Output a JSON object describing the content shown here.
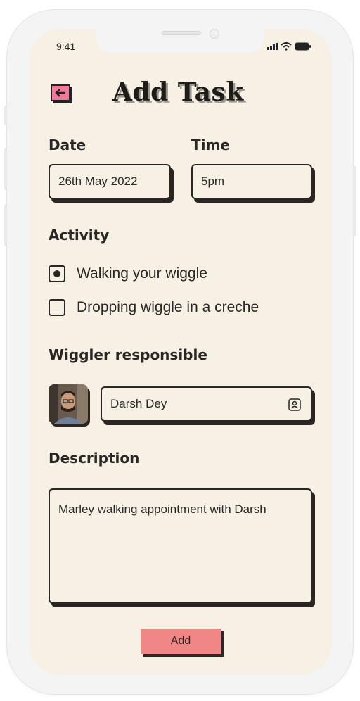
{
  "status_bar": {
    "time": "9:41"
  },
  "header": {
    "title": "Add Task"
  },
  "date": {
    "label": "Date",
    "value": "26th May 2022"
  },
  "time": {
    "label": "Time",
    "value": "5pm"
  },
  "activity": {
    "label": "Activity",
    "options": [
      {
        "label": "Walking your wiggle",
        "checked": true
      },
      {
        "label": "Dropping wiggle in a creche",
        "checked": false
      }
    ]
  },
  "responsible": {
    "label": "Wiggler responsible",
    "name": "Darsh Dey"
  },
  "description": {
    "label": "Description",
    "value": "Marley walking appointment with Darsh"
  },
  "actions": {
    "add_label": "Add"
  },
  "colors": {
    "background": "#f7f1e5",
    "accent_pink": "#f2799a",
    "button_red": "#f08686",
    "ink": "#2b2623"
  },
  "icons": [
    "back-arrow-icon",
    "signal-icon",
    "wifi-icon",
    "battery-icon",
    "contact-icon"
  ]
}
